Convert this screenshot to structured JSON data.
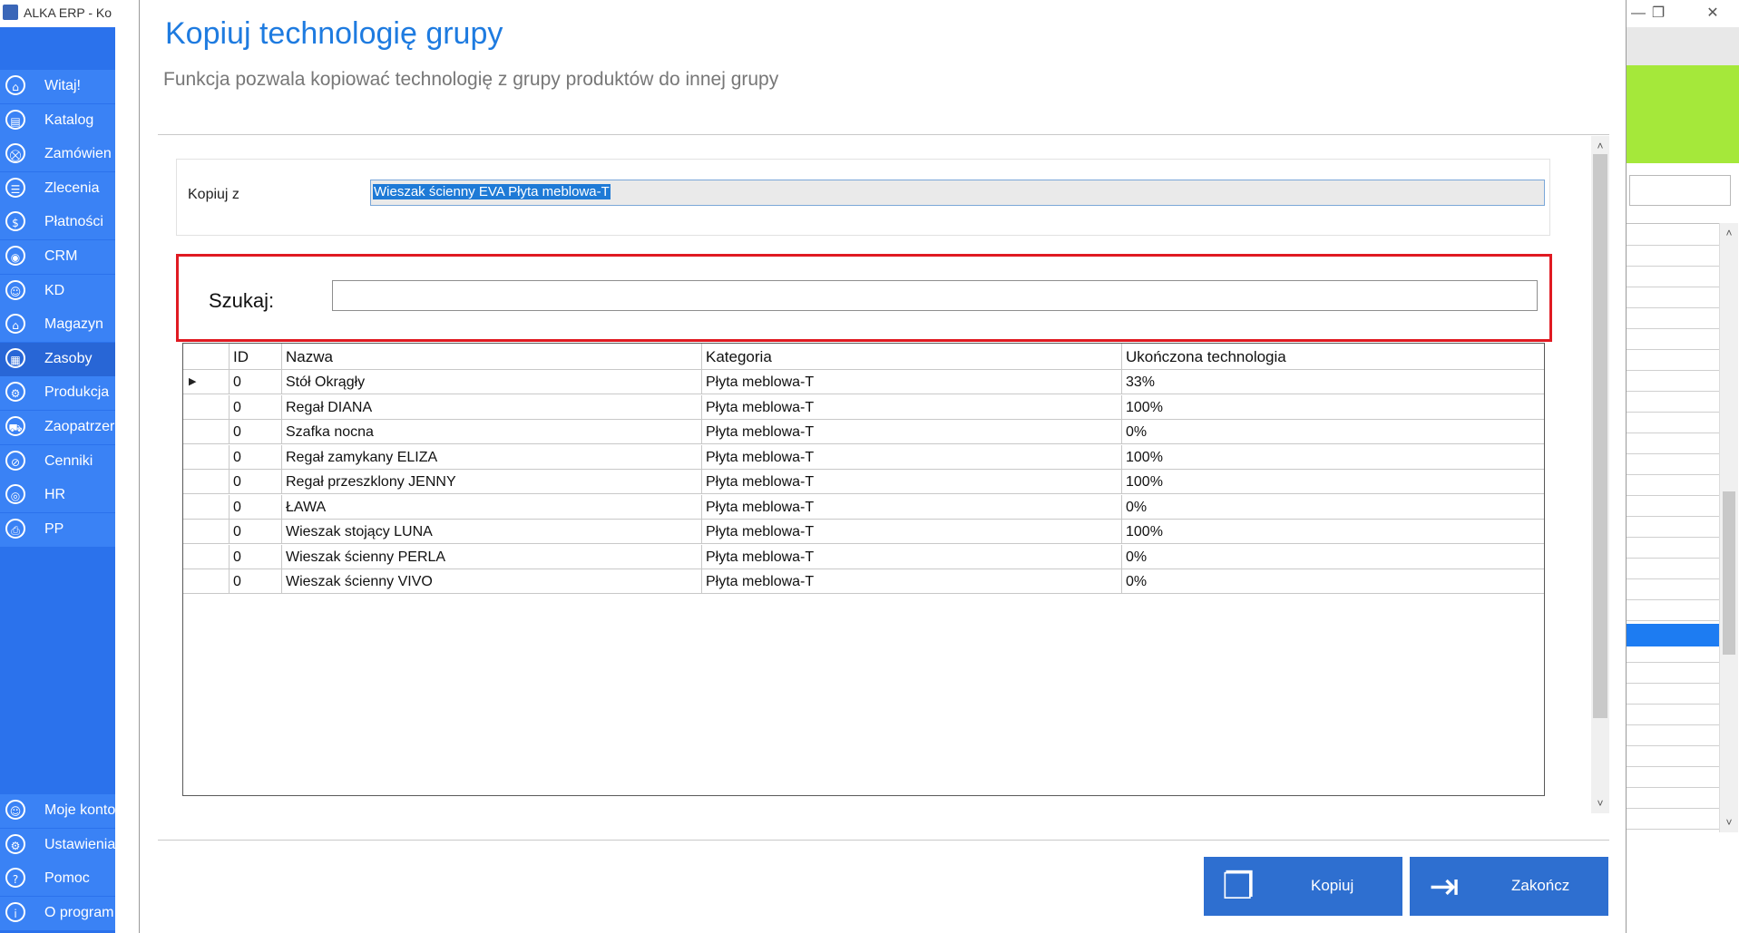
{
  "app": {
    "title": "ALKA ERP - Ko",
    "win_controls": [
      "—",
      "❐",
      "✕"
    ]
  },
  "sidebar": {
    "top_items": [
      {
        "label": "Witaj!",
        "icon": "home-icon",
        "glyph": "⌂"
      },
      {
        "label": "Katalog",
        "icon": "book-icon",
        "glyph": "▤"
      },
      {
        "label": "Zamówien",
        "icon": "cart-icon",
        "glyph": "⛒"
      },
      {
        "label": "Zlecenia",
        "icon": "list-icon",
        "glyph": "☰"
      },
      {
        "label": "Płatności",
        "icon": "dollar-icon",
        "glyph": "$"
      },
      {
        "label": "CRM",
        "icon": "crm-icon",
        "glyph": "◉"
      },
      {
        "label": "KD",
        "icon": "person-icon",
        "glyph": "☺"
      },
      {
        "label": "Magazyn",
        "icon": "warehouse-icon",
        "glyph": "⌂"
      },
      {
        "label": "Zasoby",
        "icon": "resources-icon",
        "glyph": "▦"
      },
      {
        "label": "Produkcja",
        "icon": "production-icon",
        "glyph": "⚙"
      },
      {
        "label": "Zaopatrzer",
        "icon": "truck-icon",
        "glyph": "⛟"
      },
      {
        "label": "Cenniki",
        "icon": "tag-icon",
        "glyph": "⊘"
      },
      {
        "label": "HR",
        "icon": "hr-icon",
        "glyph": "◎"
      },
      {
        "label": "PP",
        "icon": "pp-icon",
        "glyph": "⎙"
      }
    ],
    "active_index": 8,
    "bottom_items": [
      {
        "label": "Moje konto",
        "icon": "account-icon",
        "glyph": "☺"
      },
      {
        "label": "Ustawienia",
        "icon": "settings-icon",
        "glyph": "⚙"
      },
      {
        "label": "Pomoc",
        "icon": "help-icon",
        "glyph": "?"
      },
      {
        "label": "O program",
        "icon": "info-icon",
        "glyph": "i"
      }
    ]
  },
  "dialog": {
    "title": "Kopiuj technologię grupy",
    "subtitle": "Funkcja pozwala kopiować technologię z grupy produktów do innej grupy",
    "copy_from_label": "Kopiuj z",
    "copy_from_value": "Wieszak ścienny EVA Płyta meblowa-T",
    "search_label": "Szukaj:",
    "search_value": "",
    "grid": {
      "columns": [
        "ID",
        "Nazwa",
        "Kategoria",
        "Ukończona technologia"
      ],
      "rows": [
        [
          "0",
          "Stół Okrągły",
          "Płyta meblowa-T",
          "33%"
        ],
        [
          "0",
          "Regał DIANA",
          "Płyta meblowa-T",
          "100%"
        ],
        [
          "0",
          "Szafka nocna",
          "Płyta meblowa-T",
          "0%"
        ],
        [
          "0",
          "Regał zamykany ELIZA",
          "Płyta meblowa-T",
          "100%"
        ],
        [
          "0",
          "Regał przeszklony JENNY",
          "Płyta meblowa-T",
          "100%"
        ],
        [
          "0",
          "ŁAWA",
          "Płyta meblowa-T",
          "0%"
        ],
        [
          "0",
          "Wieszak stojący LUNA",
          "Płyta meblowa-T",
          "100%"
        ],
        [
          "0",
          "Wieszak ścienny PERLA",
          "Płyta meblowa-T",
          "0%"
        ],
        [
          "0",
          "Wieszak ścienny VIVO",
          "Płyta meblowa-T",
          "0%"
        ]
      ],
      "current_row_indicator": "▶"
    },
    "buttons": {
      "copy": {
        "label": "Kopiuj",
        "icon": "copy-icon"
      },
      "close": {
        "label": "Zakończ",
        "icon": "exit-icon"
      }
    },
    "colors": {
      "accent": "#1e7be0",
      "search_highlight": "#e01a22",
      "button": "#2e6fd0"
    }
  }
}
